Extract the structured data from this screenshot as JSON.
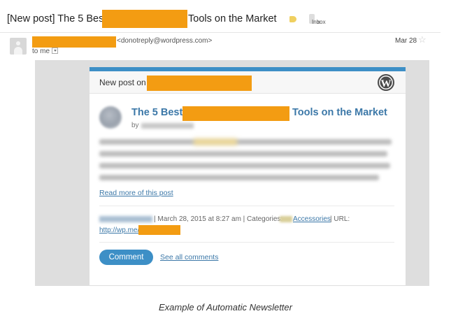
{
  "email": {
    "subject_prefix": "[New post] The 5 Best",
    "subject_suffix": "Tools on the Market",
    "label_tag_color": "#f0d060",
    "inbox_label": "Inbox",
    "inbox_close": "x",
    "sender_email": "<donotreply@wordpress.com>",
    "date": "Mar 28",
    "to_label": "to me",
    "star_icon": "☆"
  },
  "newsletter": {
    "new_post_label": "New post on",
    "wp_icon": "W",
    "title_prefix": "The 5 Best",
    "title_suffix": "Tools on the Market",
    "by_label": "by",
    "read_more": "Read more of this post",
    "meta_text": "| March 28, 2015 at 8:27 am | Categories:",
    "category": "Accessories",
    "url_label": "| URL:",
    "short_url": "http://wp.me/",
    "comment_button": "Comment",
    "see_all_comments": "See all comments"
  },
  "colors": {
    "accent": "#3d8fc6",
    "link": "#3c78a8",
    "redaction": "#f39c12"
  },
  "caption": "Example of Automatic Newsletter"
}
